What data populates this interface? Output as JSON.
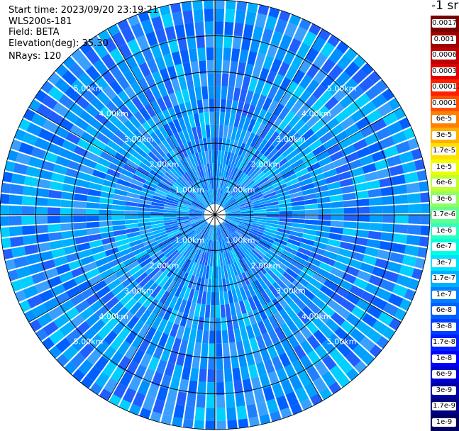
{
  "info": {
    "start_time": "Start time: 2023/09/20 23:19:21",
    "instrument": "WLS200s-181",
    "field": "Field: BETA",
    "elevation": "Elevation(deg): 35.30",
    "nrays": "NRays: 120"
  },
  "colorbar": {
    "unit_label": "-1 sr",
    "levels": [
      {
        "label": "0.0017",
        "color": "#7a0000"
      },
      {
        "label": "0.001",
        "color": "#9c0000"
      },
      {
        "label": "0.0006",
        "color": "#bf0000"
      },
      {
        "label": "0.0003",
        "color": "#e00000"
      },
      {
        "label": "0.00017",
        "color": "#ff2000"
      },
      {
        "label": "0.0001",
        "color": "#ff5000"
      },
      {
        "label": "6e-5",
        "color": "#ff8000"
      },
      {
        "label": "3e-5",
        "color": "#ffb000"
      },
      {
        "label": "1.7e-5",
        "color": "#ffe000"
      },
      {
        "label": "1e-5",
        "color": "#f0ff00"
      },
      {
        "label": "6e-6",
        "color": "#c0ff30"
      },
      {
        "label": "3e-6",
        "color": "#90ff60"
      },
      {
        "label": "1.7e-6",
        "color": "#60ff90"
      },
      {
        "label": "1e-6",
        "color": "#30ffc0"
      },
      {
        "label": "6e-7",
        "color": "#00ffe0"
      },
      {
        "label": "3e-7",
        "color": "#00e0ff"
      },
      {
        "label": "1.7e-7",
        "color": "#00b0ff"
      },
      {
        "label": "1e-7",
        "color": "#0080ff"
      },
      {
        "label": "6e-8",
        "color": "#0060ff"
      },
      {
        "label": "3e-8",
        "color": "#0040ff"
      },
      {
        "label": "1.7e-8",
        "color": "#0020ff"
      },
      {
        "label": "1e-8",
        "color": "#0000ff"
      },
      {
        "label": "6e-9",
        "color": "#0000d0"
      },
      {
        "label": "3e-9",
        "color": "#0000a0"
      },
      {
        "label": "1.7e-9",
        "color": "#000080"
      },
      {
        "label": "1e-9",
        "color": "#000060"
      }
    ]
  },
  "chart_data": {
    "type": "heatmap",
    "projection": "polar",
    "field": "BETA",
    "elevation_deg": 35.3,
    "nrays": 120,
    "range_rings_km": [
      1,
      2,
      3,
      4,
      5
    ],
    "range_ring_labels": [
      "1.00km",
      "2.00km",
      "3.00km",
      "4.00km",
      "5.00km"
    ],
    "max_range_km": 6,
    "dominant_value_range": [
      3e-08,
      3e-07
    ],
    "grid": true,
    "colorbar_position": "right"
  }
}
